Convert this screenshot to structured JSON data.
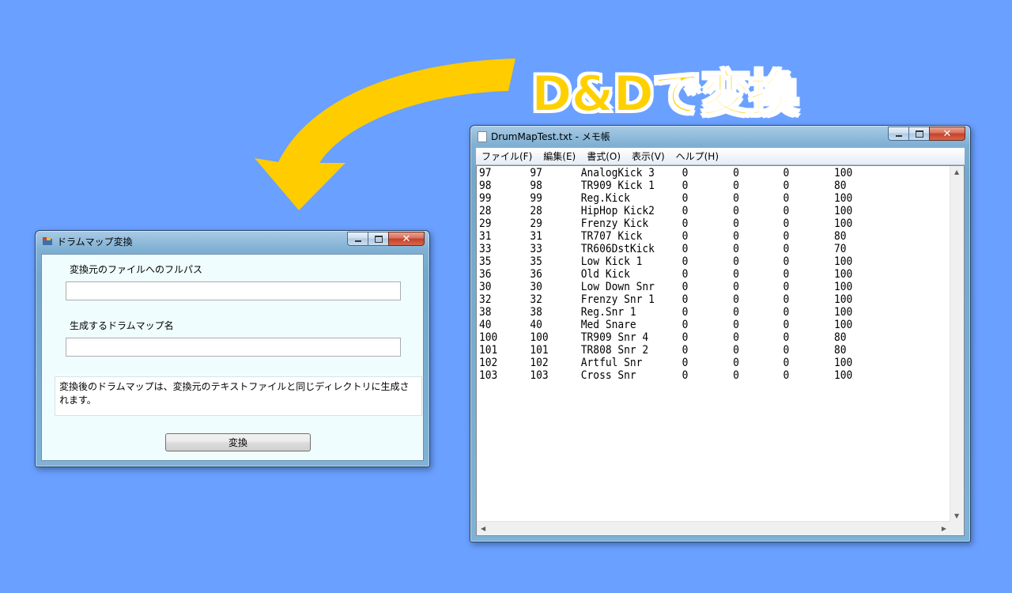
{
  "caption": "D&Dで変換",
  "dialog": {
    "title": "ドラムマップ変換",
    "source_label": "変換元のファイルへのフルパス",
    "source_value": "",
    "name_label": "生成するドラムマップ名",
    "name_value": "",
    "info_text": "変換後のドラムマップは、変換元のテキストファイルと同じディレクトリに生成されます。",
    "convert_button": "変換",
    "controls": {
      "close": "✕"
    }
  },
  "notepad": {
    "title": "DrumMapTest.txt - メモ帳",
    "menu": [
      "ファイル(F)",
      "編集(E)",
      "書式(O)",
      "表示(V)",
      "ヘルプ(H)"
    ],
    "controls": {
      "close": "✕"
    },
    "rows": [
      [
        "97",
        "97",
        "AnalogKick 3",
        "0",
        "0",
        "0",
        "100"
      ],
      [
        "98",
        "98",
        "TR909 Kick 1",
        "0",
        "0",
        "0",
        "80"
      ],
      [
        "99",
        "99",
        "Reg.Kick",
        "0",
        "0",
        "0",
        "100"
      ],
      [
        "28",
        "28",
        "HipHop Kick2",
        "0",
        "0",
        "0",
        "100"
      ],
      [
        "29",
        "29",
        "Frenzy Kick",
        "0",
        "0",
        "0",
        "100"
      ],
      [
        "31",
        "31",
        "TR707 Kick",
        "0",
        "0",
        "0",
        "80"
      ],
      [
        "33",
        "33",
        "TR606DstKick",
        "0",
        "0",
        "0",
        "70"
      ],
      [
        "35",
        "35",
        "Low Kick 1",
        "0",
        "0",
        "0",
        "100"
      ],
      [
        "36",
        "36",
        "Old Kick",
        "0",
        "0",
        "0",
        "100"
      ],
      [
        "30",
        "30",
        "Low Down Snr",
        "0",
        "0",
        "0",
        "100"
      ],
      [
        "32",
        "32",
        "Frenzy Snr 1",
        "0",
        "0",
        "0",
        "100"
      ],
      [
        "38",
        "38",
        "Reg.Snr 1",
        "0",
        "0",
        "0",
        "100"
      ],
      [
        "40",
        "40",
        "Med Snare",
        "0",
        "0",
        "0",
        "100"
      ],
      [
        "100",
        "100",
        "TR909 Snr 4",
        "0",
        "0",
        "0",
        "80"
      ],
      [
        "101",
        "101",
        "TR808 Snr 2",
        "0",
        "0",
        "0",
        "80"
      ],
      [
        "102",
        "102",
        "Artful Snr",
        "0",
        "0",
        "0",
        "100"
      ],
      [
        "103",
        "103",
        "Cross Snr",
        "0",
        "0",
        "0",
        "100"
      ]
    ]
  },
  "colors": {
    "background": "#6aa0ff",
    "arrow": "#ffcc00",
    "caption": "#ffd000"
  }
}
